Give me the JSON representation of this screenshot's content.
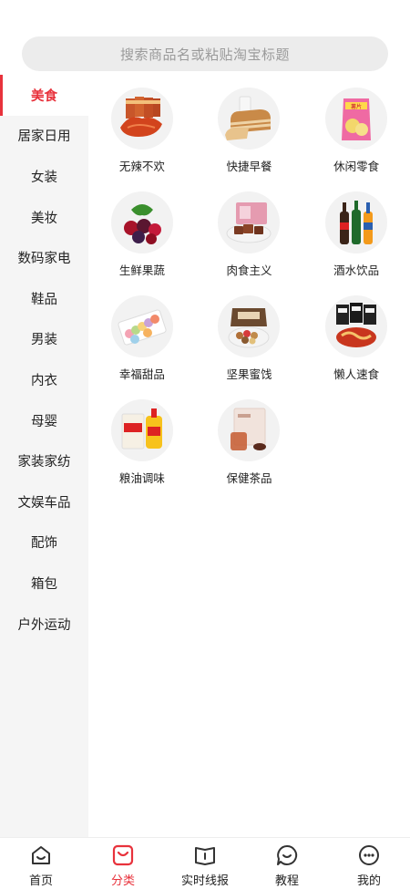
{
  "search": {
    "placeholder": "搜索商品名或粘贴淘宝标题"
  },
  "sidebar": {
    "items": [
      {
        "label": "美食",
        "active": true
      },
      {
        "label": "居家日用"
      },
      {
        "label": "女装"
      },
      {
        "label": "美妆"
      },
      {
        "label": "数码家电"
      },
      {
        "label": "鞋品"
      },
      {
        "label": "男装"
      },
      {
        "label": "内衣"
      },
      {
        "label": "母婴"
      },
      {
        "label": "家装家纺"
      },
      {
        "label": "文娱车品"
      },
      {
        "label": "配饰"
      },
      {
        "label": "箱包"
      },
      {
        "label": "户外运动"
      }
    ]
  },
  "categories": [
    {
      "label": "无辣不欢",
      "icon": "spicy-meat-icon"
    },
    {
      "label": "快捷早餐",
      "icon": "bread-icon"
    },
    {
      "label": "休闲零食",
      "icon": "snack-bag-icon"
    },
    {
      "label": "生鲜果蔬",
      "icon": "berries-icon"
    },
    {
      "label": "肉食主义",
      "icon": "meat-icon"
    },
    {
      "label": "酒水饮品",
      "icon": "bottles-icon"
    },
    {
      "label": "幸福甜品",
      "icon": "macaron-icon"
    },
    {
      "label": "坚果蜜饯",
      "icon": "nuts-icon"
    },
    {
      "label": "懒人速食",
      "icon": "instant-noodle-icon"
    },
    {
      "label": "粮油调味",
      "icon": "rice-oil-icon"
    },
    {
      "label": "保健茶品",
      "icon": "tea-icon"
    }
  ],
  "tabbar": {
    "tabs": [
      {
        "label": "首页",
        "icon": "home-icon"
      },
      {
        "label": "分类",
        "icon": "category-icon",
        "active": true
      },
      {
        "label": "实时线报",
        "icon": "book-icon"
      },
      {
        "label": "教程",
        "icon": "chat-icon"
      },
      {
        "label": "我的",
        "icon": "profile-icon"
      }
    ]
  },
  "colors": {
    "accent": "#e8323c",
    "sidebar_bg": "#f5f5f5",
    "search_bg": "#ececec"
  }
}
